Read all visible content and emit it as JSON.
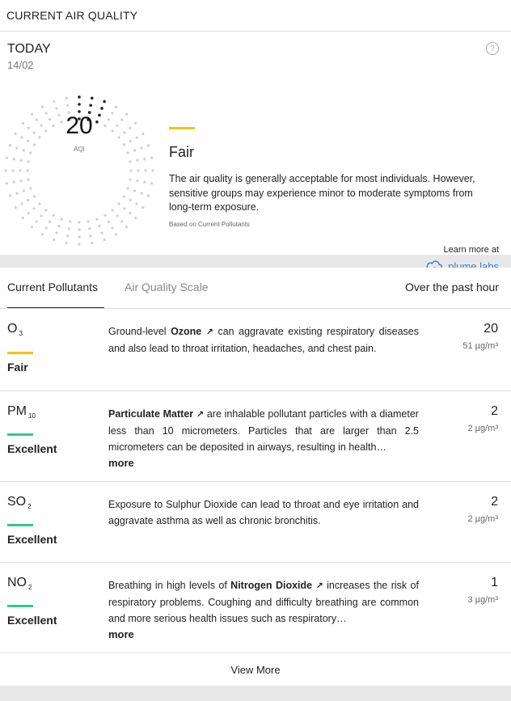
{
  "header": {
    "title": "CURRENT AIR QUALITY"
  },
  "today": {
    "label": "TODAY",
    "date": "14/02",
    "help_icon": "question-circle-icon",
    "aqi_value": "20",
    "aqi_unit": "AQI",
    "level": "Fair",
    "level_color": "#f5c400",
    "description": "The air quality is generally acceptable for most individuals. However, sensitive groups may experience minor to moderate symptoms from long-term exposure.",
    "note": "Based on Current Pollutants",
    "learn_more": "Learn more at",
    "brand": "plume labs"
  },
  "tabs": {
    "items": [
      "Current Pollutants",
      "Air Quality Scale"
    ],
    "active": "Current Pollutants",
    "timeframe": "Over the past hour"
  },
  "pollutants": [
    {
      "name": "O",
      "sub": "3",
      "status": "Fair",
      "status_color": "#f5c400",
      "desc_pre": "Ground-level ",
      "desc_link": "Ozone",
      "desc_post": " can aggravate existing respiratory diseases and also lead to throat irritation, headaches, and chest pain.",
      "value": "20",
      "unit": "51 µg/m³",
      "more": ""
    },
    {
      "name": "PM",
      "sub": "10",
      "status": "Excellent",
      "status_color": "#2ecc8a",
      "desc_pre": "",
      "desc_link": "Particulate Matter",
      "desc_post": " are inhalable pollutant particles with a diameter less than 10 micrometers. Particles that are larger than 2.5 micrometers can be deposited in airways, resulting in health…",
      "value": "2",
      "unit": "2 µg/m³",
      "more": "more"
    },
    {
      "name": "SO",
      "sub": "2",
      "status": "Excellent",
      "status_color": "#2ecc8a",
      "desc_pre": "Exposure to Sulphur Dioxide can lead to throat and eye irritation and aggravate asthma as well as chronic bronchitis.",
      "desc_link": "",
      "desc_post": "",
      "value": "2",
      "unit": "2 µg/m³",
      "more": ""
    },
    {
      "name": "NO",
      "sub": "2",
      "status": "Excellent",
      "status_color": "#2ecc8a",
      "desc_pre": "Breathing in high levels of ",
      "desc_link": "Nitrogen Dioxide",
      "desc_post": " increases the risk of respiratory problems. Coughing and difficulty breathing are common and more serious health issues such as respiratory…",
      "value": "1",
      "unit": "3 µg/m³",
      "more": "more"
    }
  ],
  "footer": {
    "view_more": "View More"
  }
}
